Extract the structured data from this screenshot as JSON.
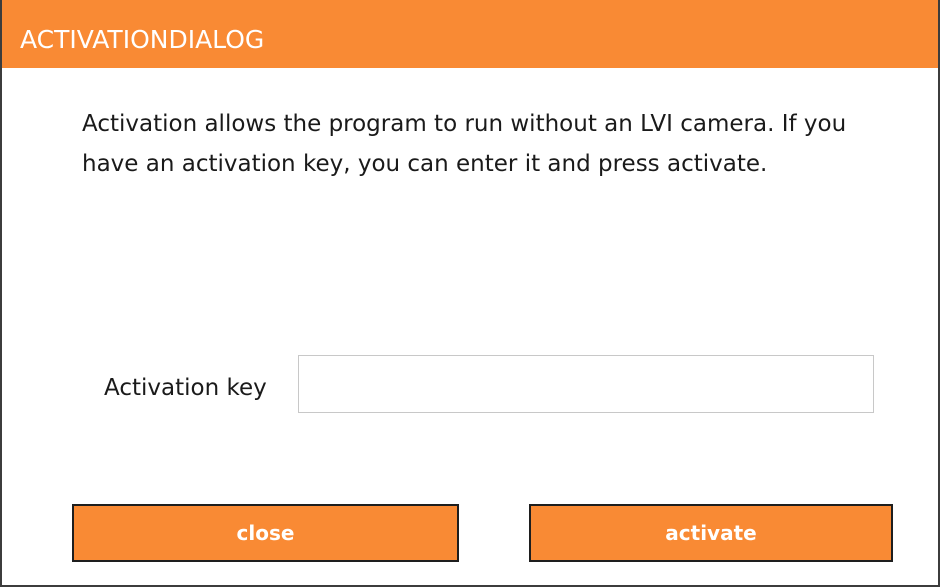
{
  "dialog": {
    "title": "ACTIVATIONDIALOG",
    "accent_color": "#f98a34",
    "description": "Activation allows the program to run without an LVI camera. If you have an activation key, you can enter it and press activate.",
    "key_label": "Activation key",
    "key_value": "",
    "close_label": "close",
    "activate_label": "activate"
  }
}
